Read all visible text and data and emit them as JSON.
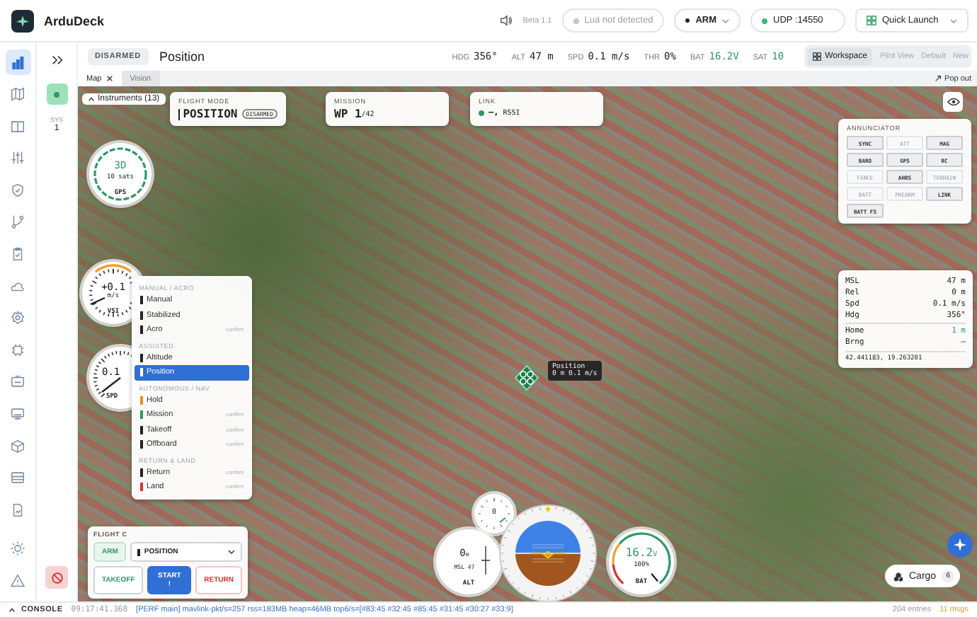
{
  "app": {
    "name": "ArduDeck"
  },
  "topbar": {
    "version": "Beta 1.1",
    "lua_status": "Lua not detected",
    "arm_menu": "ARM",
    "connection": "UDP :14550",
    "connected": true,
    "quick_launch": "Quick Launch"
  },
  "rail": [
    {
      "selected": true
    },
    {
      "selected": false
    },
    {
      "selected": false
    },
    {
      "selected": false
    },
    {
      "selected": false
    },
    {
      "selected": false
    },
    {
      "selected": false
    },
    {
      "selected": false
    },
    {
      "selected": false
    },
    {
      "selected": false
    },
    {
      "selected": false
    },
    {
      "selected": false
    },
    {
      "selected": false
    },
    {
      "selected": false
    },
    {
      "selected": false
    }
  ],
  "vehicle_panel": {
    "label": "SYS",
    "id": "1"
  },
  "status_bar": {
    "arm_state": "DISARMED",
    "mode": "Position",
    "stats": [
      {
        "label": "HDG",
        "value": "356°",
        "color": "#222222"
      },
      {
        "label": "ALT",
        "value": "47 m",
        "color": "#222222"
      },
      {
        "label": "SPD",
        "value": "0.1 m/s",
        "color": "#222222"
      },
      {
        "label": "THR",
        "value": "0%",
        "color": "#222222"
      },
      {
        "label": "BAT",
        "value": "16.2V",
        "color": "#2e9a66"
      },
      {
        "label": "SAT",
        "value": "10",
        "color": "#2e9a66"
      }
    ],
    "workspace": "Workspace",
    "layouts": [
      "Pilot View",
      "Default",
      "New"
    ]
  },
  "tabs": [
    {
      "label": "Map",
      "selected": true
    },
    {
      "label": "Vision",
      "selected": false
    }
  ],
  "pop_out": "Pop out",
  "instruments_tab": "Instruments (13)",
  "flight_mode_card": {
    "title": "FLIGHT MODE",
    "value": "POSITION",
    "badge": "DISARMED"
  },
  "mission_card": {
    "title": "MISSION",
    "value": "WP 1",
    "total": "/42"
  },
  "link_card": {
    "title": "LINK",
    "value": "—,",
    "label": "RSSI",
    "connected": true
  },
  "annunciator": {
    "title": "ANNUNCIATOR",
    "items": [
      {
        "label": "SYNC",
        "on": true
      },
      {
        "label": "ATT",
        "on": false
      },
      {
        "label": "MAG",
        "on": true
      },
      {
        "label": "BARO",
        "on": true
      },
      {
        "label": "GPS",
        "on": true
      },
      {
        "label": "RC",
        "on": true
      },
      {
        "label": "FENCE",
        "on": false
      },
      {
        "label": "AHRS",
        "on": true
      },
      {
        "label": "TERRAIN",
        "on": false
      },
      {
        "label": "BATT",
        "on": false
      },
      {
        "label": "PREARM",
        "on": false
      },
      {
        "label": "LINK",
        "on": true
      },
      {
        "label": "BATT FS",
        "on": true
      }
    ]
  },
  "gauges": [
    {
      "kind": "gps",
      "value": "3D",
      "detail": "10 sats",
      "label": "GPS"
    },
    {
      "kind": "vsi",
      "value": "+0.1",
      "detail": "m/s",
      "label": "VSI"
    },
    {
      "kind": "speed",
      "value": "0.1",
      "label": "SPD"
    }
  ],
  "vehicle": {
    "label": "Position",
    "detail": "0 m 0.1 m/s"
  },
  "telemetry": {
    "rows": [
      {
        "label": "MSL",
        "value": "47 m",
        "highlight": false
      },
      {
        "label": "Rel",
        "value": "0 m",
        "highlight": false
      },
      {
        "label": "Spd",
        "value": "0.1 m/s",
        "highlight": false
      },
      {
        "label": "Hdg",
        "value": "356°",
        "highlight": false
      },
      {
        "label": "Home",
        "value": "1 m",
        "highlight": true
      },
      {
        "label": "Brng",
        "value": "—",
        "highlight": false
      }
    ],
    "coordinates": "42.441183, 19.263201"
  },
  "mode_menu": {
    "groups": [
      {
        "title": "MANUAL / ACRO",
        "items": [
          {
            "label": "Manual",
            "color": "#222222",
            "selected": false
          },
          {
            "label": "Stabilized",
            "color": "#222222",
            "selected": false
          },
          {
            "label": "Acro",
            "color": "#222222",
            "hint": "confirm",
            "selected": false
          }
        ]
      },
      {
        "title": "ASSISTED",
        "items": [
          {
            "label": "Altitude",
            "color": "#222222",
            "selected": false
          },
          {
            "label": "Position",
            "color": "#ffffff",
            "selected": true
          }
        ]
      },
      {
        "title": "AUTONOMOUS / NAV",
        "items": [
          {
            "label": "Hold",
            "color": "#f08a1c",
            "selected": false
          },
          {
            "label": "Mission",
            "color": "#2e9a66",
            "hint": "confirm",
            "selected": false
          },
          {
            "label": "Takeoff",
            "color": "#222222",
            "hint": "confirm",
            "selected": false
          },
          {
            "label": "Offboard",
            "color": "#222222",
            "hint": "confirm",
            "selected": false
          }
        ]
      },
      {
        "title": "RETURN & LAND",
        "items": [
          {
            "label": "Return",
            "color": "#222222",
            "hint": "confirm",
            "selected": false
          },
          {
            "label": "Land",
            "color": "#e03030",
            "hint": "confirm",
            "selected": false
          }
        ]
      }
    ]
  },
  "flight_control": {
    "title": "FLIGHT C",
    "arm": "ARM",
    "mode": "POSITION",
    "buttons": [
      {
        "label": "TAKEOFF",
        "kind": "outline"
      },
      {
        "label": "START !",
        "kind": "primary"
      },
      {
        "label": "RETURN",
        "kind": "danger"
      }
    ]
  },
  "small_vsi": {
    "value": "0"
  },
  "alt_gauge": {
    "value": "0",
    "unit": "m",
    "detail": "MSL 47",
    "label": "ALT"
  },
  "battery_gauge": {
    "value": "16.2",
    "unit": "V",
    "detail": "100%",
    "label": "BAT",
    "level": 1
  },
  "cargo": {
    "label": "Cargo",
    "count": "6"
  },
  "console": {
    "label": "CONSOLE",
    "time": "09:17:41.368",
    "message": "[PERF main] mavlink-pkt/s=257 rss=183MB heap=46MB top6/s=[#83:45 #32:45 #85:45 #31:45 #30:27 #33:9]",
    "entries": "204 entries",
    "messages": "11 msgs"
  }
}
